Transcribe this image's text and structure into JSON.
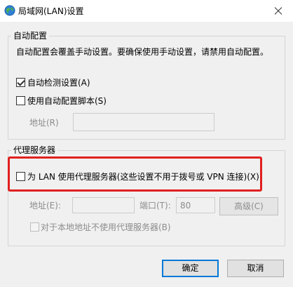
{
  "window": {
    "title": "局域网(LAN)设置",
    "icon": "globe-network-icon",
    "close_icon": "close-icon"
  },
  "auto_config": {
    "group_label": "自动配置",
    "description": "自动配置会覆盖手动设置。要确保使用手动设置，请禁用自动配置。",
    "auto_detect": {
      "label": "自动检测设置(A)",
      "checked": true
    },
    "use_script": {
      "label": "使用自动配置脚本(S)",
      "checked": false
    },
    "address_label": "地址(R)",
    "address_value": ""
  },
  "proxy": {
    "group_label": "代理服务器",
    "use_proxy": {
      "label": "为 LAN 使用代理服务器(这些设置不用于拨号或 VPN 连接)(X)",
      "checked": false
    },
    "address_label": "地址(E):",
    "address_value": "",
    "port_label": "端口(T):",
    "port_value": "80",
    "advanced_label": "高级(C)",
    "bypass": {
      "label": "对于本地地址不使用代理服务器(B)",
      "checked": false
    }
  },
  "buttons": {
    "ok": "确定",
    "cancel": "取消"
  },
  "colors": {
    "highlight_border": "#e0201f",
    "default_button_border": "#0078d7",
    "disabled_text": "#8c8c8c"
  }
}
